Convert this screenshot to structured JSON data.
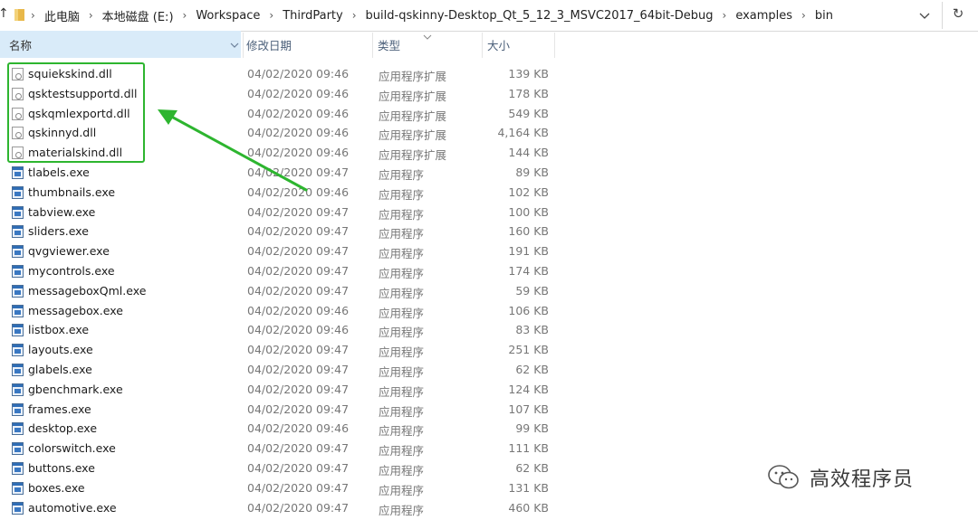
{
  "breadcrumb": [
    "此电脑",
    "本地磁盘 (E:)",
    "Workspace",
    "ThirdParty",
    "build-qskinny-Desktop_Qt_5_12_3_MSVC2017_64bit-Debug",
    "examples",
    "bin"
  ],
  "columns": {
    "name": "名称",
    "date": "修改日期",
    "type": "类型",
    "size": "大小"
  },
  "files": [
    {
      "name": "squiekskind.dll",
      "date": "04/02/2020 09:46",
      "type": "应用程序扩展",
      "size": "139 KB",
      "kind": "dll"
    },
    {
      "name": "qsktestsupportd.dll",
      "date": "04/02/2020 09:46",
      "type": "应用程序扩展",
      "size": "178 KB",
      "kind": "dll"
    },
    {
      "name": "qskqmlexportd.dll",
      "date": "04/02/2020 09:46",
      "type": "应用程序扩展",
      "size": "549 KB",
      "kind": "dll"
    },
    {
      "name": "qskinnyd.dll",
      "date": "04/02/2020 09:46",
      "type": "应用程序扩展",
      "size": "4,164 KB",
      "kind": "dll"
    },
    {
      "name": "materialskind.dll",
      "date": "04/02/2020 09:46",
      "type": "应用程序扩展",
      "size": "144 KB",
      "kind": "dll"
    },
    {
      "name": "tlabels.exe",
      "date": "04/02/2020 09:47",
      "type": "应用程序",
      "size": "89 KB",
      "kind": "exe"
    },
    {
      "name": "thumbnails.exe",
      "date": "04/02/2020 09:46",
      "type": "应用程序",
      "size": "102 KB",
      "kind": "exe"
    },
    {
      "name": "tabview.exe",
      "date": "04/02/2020 09:47",
      "type": "应用程序",
      "size": "100 KB",
      "kind": "exe"
    },
    {
      "name": "sliders.exe",
      "date": "04/02/2020 09:47",
      "type": "应用程序",
      "size": "160 KB",
      "kind": "exe"
    },
    {
      "name": "qvgviewer.exe",
      "date": "04/02/2020 09:47",
      "type": "应用程序",
      "size": "191 KB",
      "kind": "exe"
    },
    {
      "name": "mycontrols.exe",
      "date": "04/02/2020 09:47",
      "type": "应用程序",
      "size": "174 KB",
      "kind": "exe"
    },
    {
      "name": "messageboxQml.exe",
      "date": "04/02/2020 09:47",
      "type": "应用程序",
      "size": "59 KB",
      "kind": "exe"
    },
    {
      "name": "messagebox.exe",
      "date": "04/02/2020 09:46",
      "type": "应用程序",
      "size": "106 KB",
      "kind": "exe"
    },
    {
      "name": "listbox.exe",
      "date": "04/02/2020 09:46",
      "type": "应用程序",
      "size": "83 KB",
      "kind": "exe"
    },
    {
      "name": "layouts.exe",
      "date": "04/02/2020 09:47",
      "type": "应用程序",
      "size": "251 KB",
      "kind": "exe"
    },
    {
      "name": "glabels.exe",
      "date": "04/02/2020 09:47",
      "type": "应用程序",
      "size": "62 KB",
      "kind": "exe"
    },
    {
      "name": "gbenchmark.exe",
      "date": "04/02/2020 09:47",
      "type": "应用程序",
      "size": "124 KB",
      "kind": "exe"
    },
    {
      "name": "frames.exe",
      "date": "04/02/2020 09:47",
      "type": "应用程序",
      "size": "107 KB",
      "kind": "exe"
    },
    {
      "name": "desktop.exe",
      "date": "04/02/2020 09:46",
      "type": "应用程序",
      "size": "99 KB",
      "kind": "exe"
    },
    {
      "name": "colorswitch.exe",
      "date": "04/02/2020 09:47",
      "type": "应用程序",
      "size": "111 KB",
      "kind": "exe"
    },
    {
      "name": "buttons.exe",
      "date": "04/02/2020 09:47",
      "type": "应用程序",
      "size": "62 KB",
      "kind": "exe"
    },
    {
      "name": "boxes.exe",
      "date": "04/02/2020 09:47",
      "type": "应用程序",
      "size": "131 KB",
      "kind": "exe"
    },
    {
      "name": "automotive.exe",
      "date": "04/02/2020 09:47",
      "type": "应用程序",
      "size": "460 KB",
      "kind": "exe"
    }
  ],
  "watermark": {
    "text": "高效程序员"
  },
  "colors": {
    "highlight": "#2db52f",
    "header_selected": "#d9ebf9",
    "folder": "#e8b84a"
  }
}
